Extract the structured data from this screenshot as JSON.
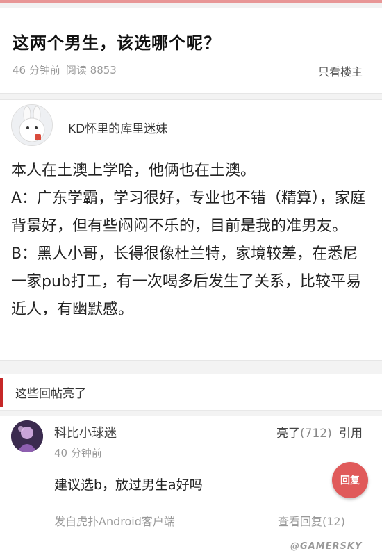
{
  "post": {
    "title": "这两个男生，该选哪个呢？",
    "time": "46 分钟前",
    "read_label": "阅读",
    "read_count": "8853",
    "only_op": "只看楼主"
  },
  "op": {
    "username": "KD怀里的库里迷妹",
    "avatar_icon": "bunny-avatar-icon",
    "paragraphs": [
      "本人在土澳上学哈，他俩也在土澳。",
      "A：广东学霸，学习很好，专业也不错（精算），家庭背景好，但有些闷闷不乐的，目前是我的准男友。",
      "B：黑人小哥，长得很像杜兰特，家境较差，在悉尼一家pub打工，有一次喝多后发生了关系，比较平易近人，有幽默感。"
    ]
  },
  "section": {
    "title": "这些回帖亮了",
    "accent_color": "#c62828"
  },
  "reply": {
    "username": "科比小球迷",
    "time": "40 分钟前",
    "like_label": "亮了",
    "like_count": "(712)",
    "cite_label": "引用",
    "text": "建议选b，放过男生a好吗",
    "reply_button": "回复",
    "source": "发自虎扑Android客户端",
    "view_replies": "查看回复(12)",
    "button_color": "#e05a5a"
  },
  "watermark": "@GAMERSKY"
}
